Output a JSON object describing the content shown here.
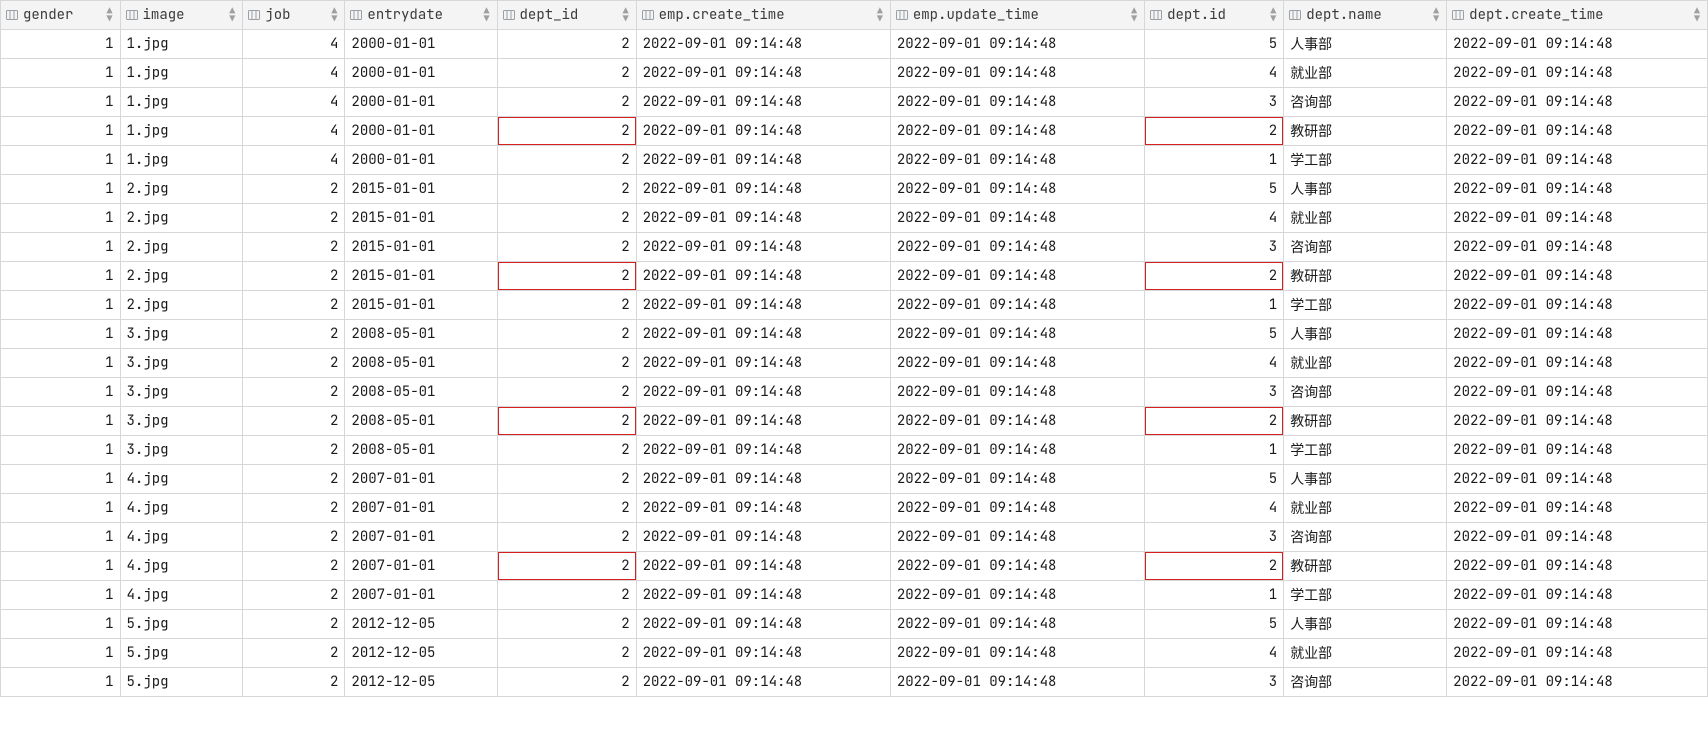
{
  "columns": [
    {
      "name": "gender",
      "align": "num"
    },
    {
      "name": "image",
      "align": "txt"
    },
    {
      "name": "job",
      "align": "num"
    },
    {
      "name": "entrydate",
      "align": "txt"
    },
    {
      "name": "dept_id",
      "align": "num"
    },
    {
      "name": "emp.create_time",
      "align": "txt"
    },
    {
      "name": "emp.update_time",
      "align": "txt"
    },
    {
      "name": "dept.id",
      "align": "num"
    },
    {
      "name": "dept.name",
      "align": "txt"
    },
    {
      "name": "dept.create_time",
      "align": "txt"
    }
  ],
  "highlight_on": {
    "dept_id_col": 4,
    "dept_id_value": "2",
    "deptid_col": 7,
    "deptid_value": "2"
  },
  "rows": [
    [
      "1",
      "1.jpg",
      "4",
      "2000-01-01",
      "2",
      "2022-09-01 09:14:48",
      "2022-09-01 09:14:48",
      "5",
      "人事部",
      "2022-09-01 09:14:48"
    ],
    [
      "1",
      "1.jpg",
      "4",
      "2000-01-01",
      "2",
      "2022-09-01 09:14:48",
      "2022-09-01 09:14:48",
      "4",
      "就业部",
      "2022-09-01 09:14:48"
    ],
    [
      "1",
      "1.jpg",
      "4",
      "2000-01-01",
      "2",
      "2022-09-01 09:14:48",
      "2022-09-01 09:14:48",
      "3",
      "咨询部",
      "2022-09-01 09:14:48"
    ],
    [
      "1",
      "1.jpg",
      "4",
      "2000-01-01",
      "2",
      "2022-09-01 09:14:48",
      "2022-09-01 09:14:48",
      "2",
      "教研部",
      "2022-09-01 09:14:48"
    ],
    [
      "1",
      "1.jpg",
      "4",
      "2000-01-01",
      "2",
      "2022-09-01 09:14:48",
      "2022-09-01 09:14:48",
      "1",
      "学工部",
      "2022-09-01 09:14:48"
    ],
    [
      "1",
      "2.jpg",
      "2",
      "2015-01-01",
      "2",
      "2022-09-01 09:14:48",
      "2022-09-01 09:14:48",
      "5",
      "人事部",
      "2022-09-01 09:14:48"
    ],
    [
      "1",
      "2.jpg",
      "2",
      "2015-01-01",
      "2",
      "2022-09-01 09:14:48",
      "2022-09-01 09:14:48",
      "4",
      "就业部",
      "2022-09-01 09:14:48"
    ],
    [
      "1",
      "2.jpg",
      "2",
      "2015-01-01",
      "2",
      "2022-09-01 09:14:48",
      "2022-09-01 09:14:48",
      "3",
      "咨询部",
      "2022-09-01 09:14:48"
    ],
    [
      "1",
      "2.jpg",
      "2",
      "2015-01-01",
      "2",
      "2022-09-01 09:14:48",
      "2022-09-01 09:14:48",
      "2",
      "教研部",
      "2022-09-01 09:14:48"
    ],
    [
      "1",
      "2.jpg",
      "2",
      "2015-01-01",
      "2",
      "2022-09-01 09:14:48",
      "2022-09-01 09:14:48",
      "1",
      "学工部",
      "2022-09-01 09:14:48"
    ],
    [
      "1",
      "3.jpg",
      "2",
      "2008-05-01",
      "2",
      "2022-09-01 09:14:48",
      "2022-09-01 09:14:48",
      "5",
      "人事部",
      "2022-09-01 09:14:48"
    ],
    [
      "1",
      "3.jpg",
      "2",
      "2008-05-01",
      "2",
      "2022-09-01 09:14:48",
      "2022-09-01 09:14:48",
      "4",
      "就业部",
      "2022-09-01 09:14:48"
    ],
    [
      "1",
      "3.jpg",
      "2",
      "2008-05-01",
      "2",
      "2022-09-01 09:14:48",
      "2022-09-01 09:14:48",
      "3",
      "咨询部",
      "2022-09-01 09:14:48"
    ],
    [
      "1",
      "3.jpg",
      "2",
      "2008-05-01",
      "2",
      "2022-09-01 09:14:48",
      "2022-09-01 09:14:48",
      "2",
      "教研部",
      "2022-09-01 09:14:48"
    ],
    [
      "1",
      "3.jpg",
      "2",
      "2008-05-01",
      "2",
      "2022-09-01 09:14:48",
      "2022-09-01 09:14:48",
      "1",
      "学工部",
      "2022-09-01 09:14:48"
    ],
    [
      "1",
      "4.jpg",
      "2",
      "2007-01-01",
      "2",
      "2022-09-01 09:14:48",
      "2022-09-01 09:14:48",
      "5",
      "人事部",
      "2022-09-01 09:14:48"
    ],
    [
      "1",
      "4.jpg",
      "2",
      "2007-01-01",
      "2",
      "2022-09-01 09:14:48",
      "2022-09-01 09:14:48",
      "4",
      "就业部",
      "2022-09-01 09:14:48"
    ],
    [
      "1",
      "4.jpg",
      "2",
      "2007-01-01",
      "2",
      "2022-09-01 09:14:48",
      "2022-09-01 09:14:48",
      "3",
      "咨询部",
      "2022-09-01 09:14:48"
    ],
    [
      "1",
      "4.jpg",
      "2",
      "2007-01-01",
      "2",
      "2022-09-01 09:14:48",
      "2022-09-01 09:14:48",
      "2",
      "教研部",
      "2022-09-01 09:14:48"
    ],
    [
      "1",
      "4.jpg",
      "2",
      "2007-01-01",
      "2",
      "2022-09-01 09:14:48",
      "2022-09-01 09:14:48",
      "1",
      "学工部",
      "2022-09-01 09:14:48"
    ],
    [
      "1",
      "5.jpg",
      "2",
      "2012-12-05",
      "2",
      "2022-09-01 09:14:48",
      "2022-09-01 09:14:48",
      "5",
      "人事部",
      "2022-09-01 09:14:48"
    ],
    [
      "1",
      "5.jpg",
      "2",
      "2012-12-05",
      "2",
      "2022-09-01 09:14:48",
      "2022-09-01 09:14:48",
      "4",
      "就业部",
      "2022-09-01 09:14:48"
    ],
    [
      "1",
      "5.jpg",
      "2",
      "2012-12-05",
      "2",
      "2022-09-01 09:14:48",
      "2022-09-01 09:14:48",
      "3",
      "咨询部",
      "2022-09-01 09:14:48"
    ]
  ]
}
